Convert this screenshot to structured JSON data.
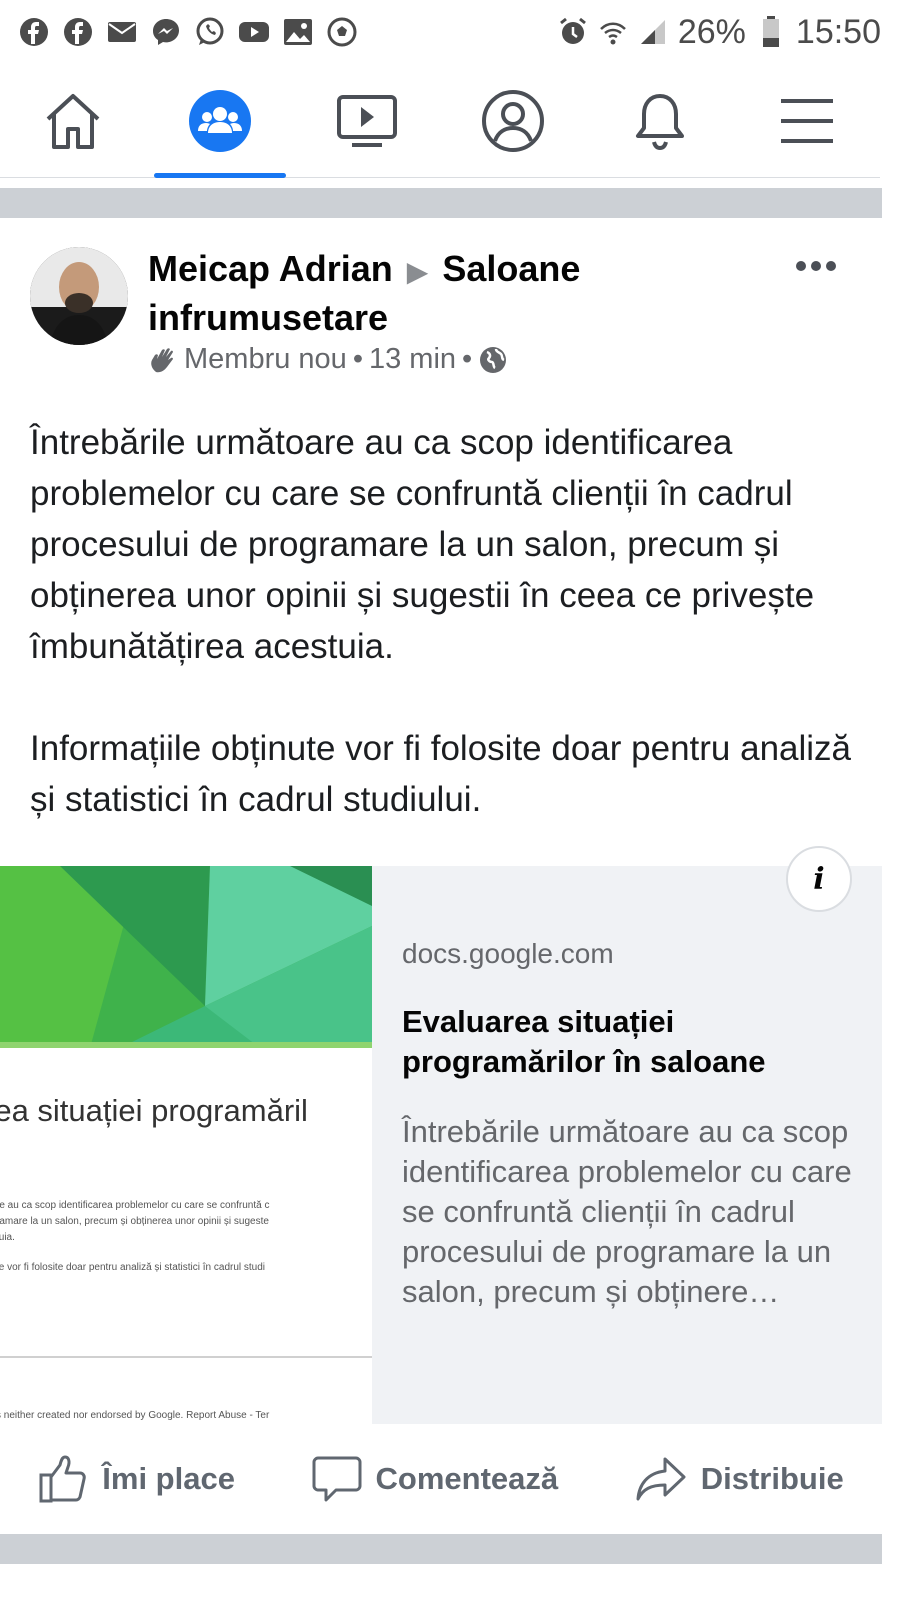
{
  "status_bar": {
    "notification_icons": [
      "facebook-icon",
      "facebook-icon",
      "mail-icon",
      "messenger-icon",
      "whatsapp-icon",
      "youtube-icon",
      "gallery-icon",
      "soccer-icon"
    ],
    "battery": "26%",
    "time": "15:50"
  },
  "nav": {
    "tabs": [
      "home-icon",
      "groups-icon",
      "watch-icon",
      "profile-icon",
      "notifications-icon",
      "menu-icon"
    ],
    "active_tab": "groups-icon",
    "accent": "#1877f2"
  },
  "post": {
    "author": "Meicap Adrian",
    "group": "Saloane infrumusetare",
    "badge": "Membru nou",
    "time": "13 min",
    "separator": "•",
    "paragraphs": [
      "Întrebările următoare au ca scop identificarea problemelor cu care se confruntă clienții în cadrul procesului de programare la un salon, precum și obținerea unor opinii și sugestii în ceea ce privește îmbunătățirea acestuia.",
      "Informațiile obținute vor fi folosite doar pentru analiză și statistici în cadrul studiului."
    ]
  },
  "link_preview": {
    "thumb_title_line1": "rea situației programăril",
    "thumb_title_line2": "e",
    "thumb_small_1": "re au ca scop identificarea problemelor cu care se confruntă c",
    "thumb_small_2": "ramare la un salon, precum și obținerea unor opinii și sugeste",
    "thumb_small_3": "tuia.",
    "thumb_small_4": "te vor fi folosite doar pentru analiză și statistici în cadrul studi",
    "thumb_footer": "s neither created nor endorsed by Google. Report Abuse - Ter",
    "info": "i",
    "domain": "docs.google.com",
    "title": "Evaluarea situației programărilor în saloane",
    "description": "Întrebările următoare au ca scop identificarea problemelor cu care se confruntă clienții în cadrul procesului de programare la un salon, precum și obținere…"
  },
  "actions": {
    "like": "Îmi place",
    "comment": "Comentează",
    "share": "Distribuie"
  }
}
